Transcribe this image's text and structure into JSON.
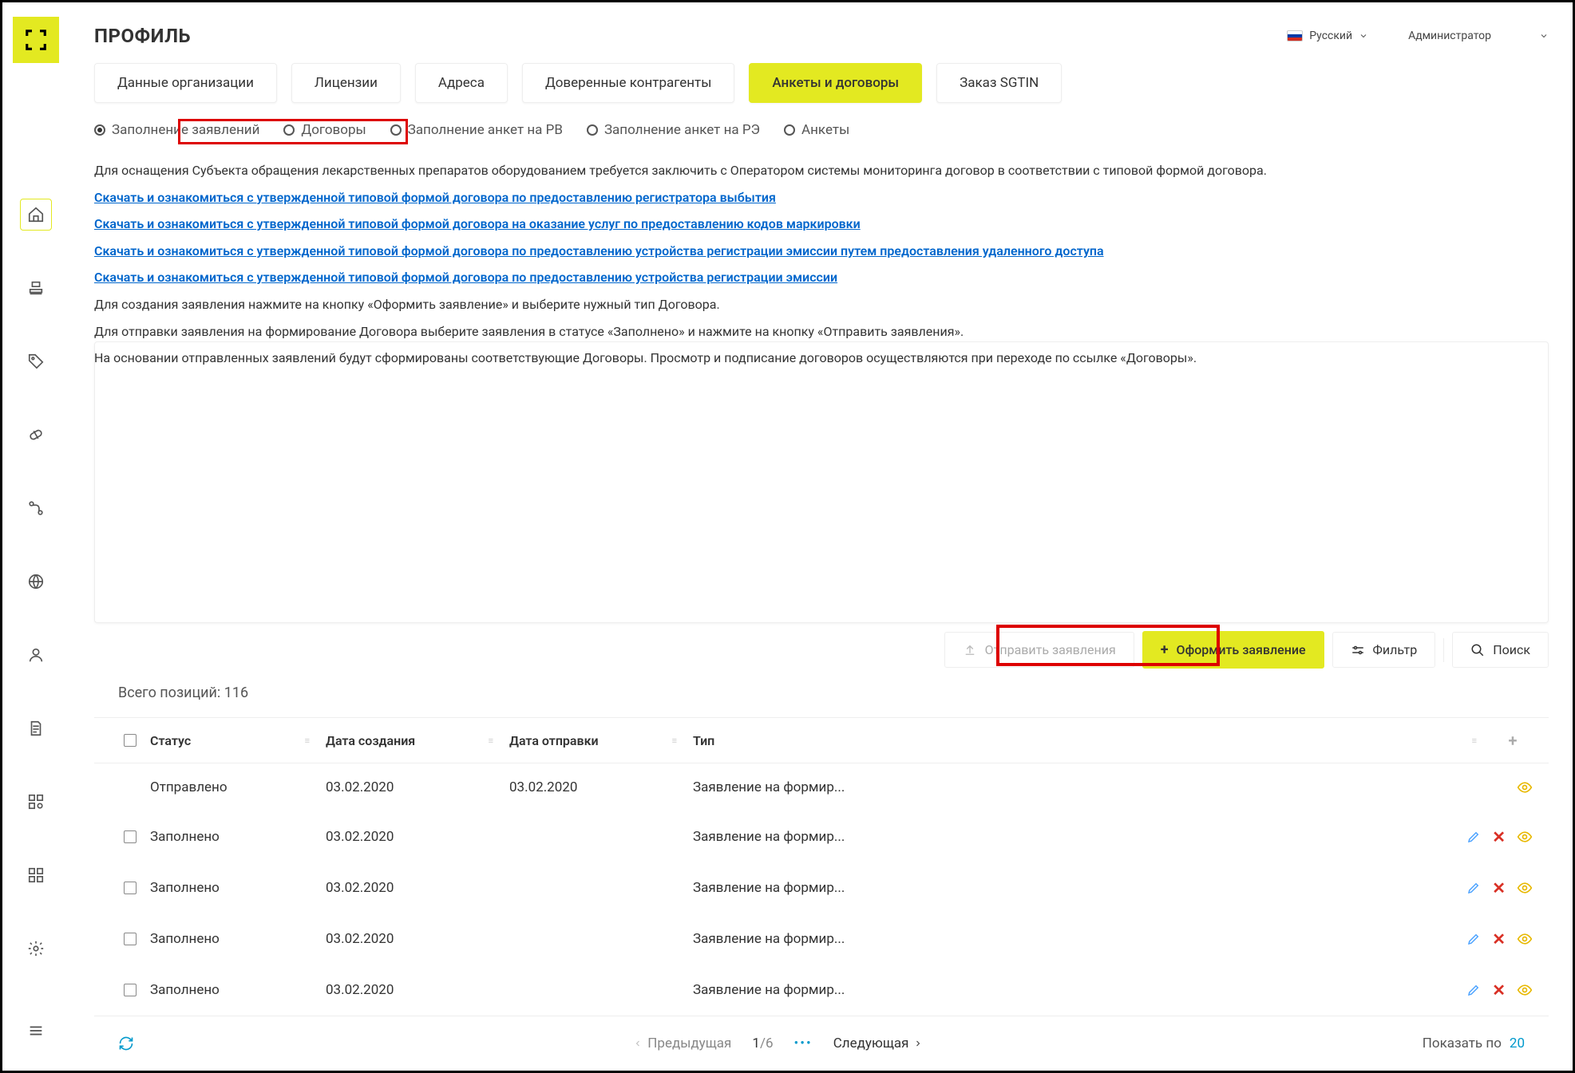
{
  "header": {
    "title": "ПРОФИЛЬ",
    "language": "Русский",
    "user_role": "Администратор"
  },
  "tabs": [
    {
      "label": "Данные организации",
      "active": false
    },
    {
      "label": "Лицензии",
      "active": false
    },
    {
      "label": "Адреса",
      "active": false
    },
    {
      "label": "Доверенные контрагенты",
      "active": false
    },
    {
      "label": "Анкеты и договоры",
      "active": true
    },
    {
      "label": "Заказ SGTIN",
      "active": false
    }
  ],
  "radio_options": [
    {
      "label": "Заполнение заявлений",
      "checked": true
    },
    {
      "label": "Договоры",
      "checked": false
    },
    {
      "label": "Заполнение анкет на РВ",
      "checked": false
    },
    {
      "label": "Заполнение анкет на РЭ",
      "checked": false
    },
    {
      "label": "Анкеты",
      "checked": false
    }
  ],
  "info": {
    "intro": "Для оснащения Субъекта обращения лекарственных препаратов оборудованием требуется заключить с Оператором системы мониторинга договор в соответствии с типовой формой договора.",
    "links": [
      "Скачать и ознакомиться с утвержденной типовой формой договора по предоставлению регистратора выбытия",
      "Скачать и ознакомиться с утвержденной типовой формой договора на оказание услуг по предоставлению кодов маркировки",
      "Скачать и ознакомиться с утвержденной типовой формой договора по предоставлению устройства регистрации эмиссии путем предоставления удаленного доступа",
      "Скачать и ознакомиться с утвержденной типовой формой договора по предоставлению устройства регистрации эмиссии"
    ],
    "para1": "Для создания заявления нажмите на кнопку «Оформить заявление» и выберите нужный тип Договора.",
    "para2": "Для отправки заявления на формирование Договора выберите заявления в статусе «Заполнено» и нажмите на кнопку «Отправить заявления».",
    "para3": "На основании отправленных заявлений будут сформированы соответствующие Договоры. Просмотр и подписание договоров осуществляются при переходе по ссылке «Договоры»."
  },
  "toolbar": {
    "send_label": "Отправить заявления",
    "create_label": "Оформить заявление",
    "filter_label": "Фильтр",
    "search_label": "Поиск"
  },
  "table": {
    "total_label": "Всего позиций: 116",
    "columns": {
      "status": "Статус",
      "created": "Дата создания",
      "sent": "Дата отправки",
      "type": "Тип"
    },
    "rows": [
      {
        "status": "Отправлено",
        "created": "03.02.2020",
        "sent": "03.02.2020",
        "type": "Заявление на формир...",
        "checkbox": false,
        "editable": false
      },
      {
        "status": "Заполнено",
        "created": "03.02.2020",
        "sent": "",
        "type": "Заявление на формир...",
        "checkbox": true,
        "editable": true
      },
      {
        "status": "Заполнено",
        "created": "03.02.2020",
        "sent": "",
        "type": "Заявление на формир...",
        "checkbox": true,
        "editable": true
      },
      {
        "status": "Заполнено",
        "created": "03.02.2020",
        "sent": "",
        "type": "Заявление на формир...",
        "checkbox": true,
        "editable": true
      },
      {
        "status": "Заполнено",
        "created": "03.02.2020",
        "sent": "",
        "type": "Заявление на формир...",
        "checkbox": true,
        "editable": true
      }
    ]
  },
  "pagination": {
    "prev": "Предыдущая",
    "current": "1",
    "total": "/6",
    "next": "Следующая",
    "show_label": "Показать по",
    "page_size": "20"
  }
}
